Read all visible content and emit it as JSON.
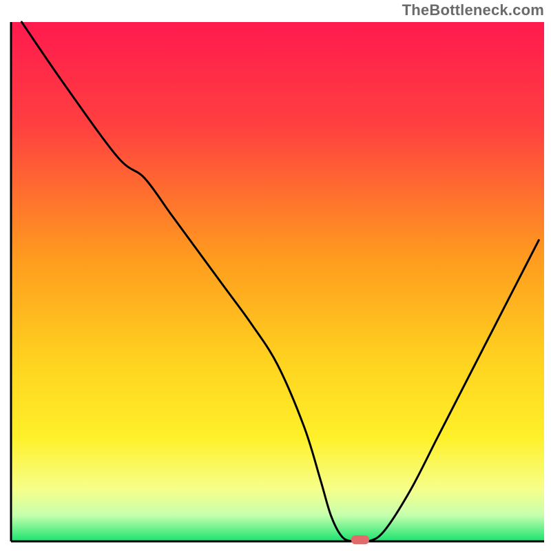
{
  "watermark": "TheBottleneck.com",
  "chart_data": {
    "type": "line",
    "title": "",
    "xlabel": "",
    "ylabel": "",
    "xlim": [
      0,
      100
    ],
    "ylim": [
      0,
      100
    ],
    "grid": false,
    "legend": false,
    "annotations": [],
    "series": [
      {
        "name": "curve",
        "x": [
          2,
          10,
          20,
          25,
          30,
          35,
          40,
          45,
          50,
          55,
          58,
          60,
          62,
          64,
          67,
          70,
          75,
          80,
          85,
          90,
          95,
          99
        ],
        "y": [
          100,
          88,
          74,
          70,
          63,
          56,
          49,
          42,
          34,
          22,
          12,
          5,
          1,
          0,
          0,
          2,
          10,
          20,
          30,
          40,
          50,
          58
        ]
      }
    ],
    "marker": {
      "x": 65.5,
      "y": 0.3
    },
    "background": {
      "type": "vertical-gradient",
      "stops": [
        {
          "pos": 0.0,
          "color": "#ff1a4e"
        },
        {
          "pos": 0.2,
          "color": "#ff4040"
        },
        {
          "pos": 0.45,
          "color": "#ff9a1f"
        },
        {
          "pos": 0.65,
          "color": "#ffd21f"
        },
        {
          "pos": 0.8,
          "color": "#fff02a"
        },
        {
          "pos": 0.9,
          "color": "#f6ff8a"
        },
        {
          "pos": 0.95,
          "color": "#c6ffae"
        },
        {
          "pos": 1.0,
          "color": "#19e36e"
        }
      ]
    },
    "axes_color": "#000000",
    "curve_color": "#000000",
    "marker_color": "#e26a6a"
  }
}
